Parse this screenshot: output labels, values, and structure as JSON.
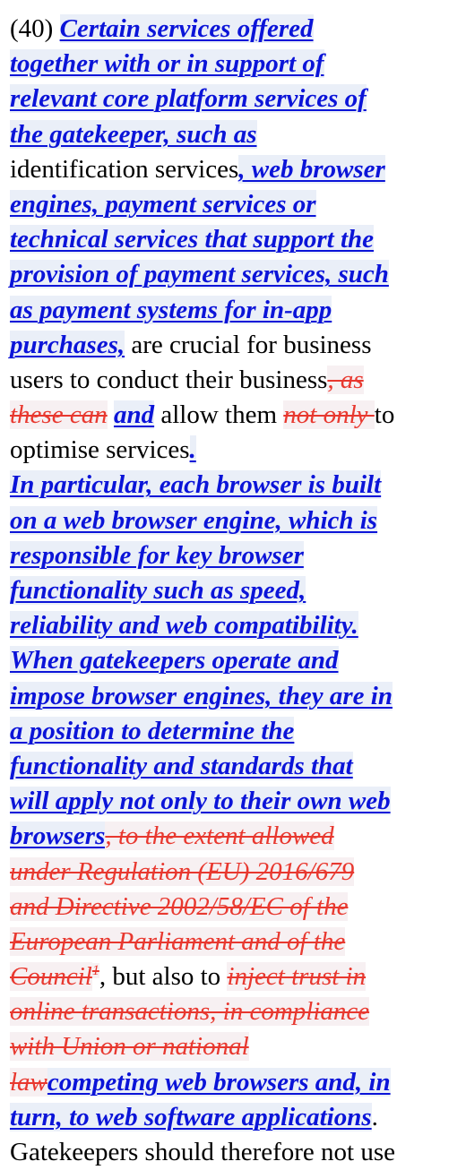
{
  "document": {
    "recital_number": "(40)",
    "colors": {
      "inserted_text": "#0b14d8",
      "deleted_text": "#e8382f",
      "plain_text": "#000000",
      "insert_highlight": "#eaeff8",
      "delete_highlight": "#f7f0f2"
    },
    "lines": [
      [
        {
          "t": "num",
          "v": "(40)  "
        },
        {
          "t": "ins",
          "v": "Certain services offered"
        }
      ],
      [
        {
          "t": "ins",
          "v": "together with or in support of"
        }
      ],
      [
        {
          "t": "ins",
          "v": "relevant core platform services of"
        }
      ],
      [
        {
          "t": "ins",
          "v": "the gatekeeper, such as"
        }
      ],
      [
        {
          "t": "plain",
          "v": "identification services"
        },
        {
          "t": "ins",
          "v": ", web browser"
        }
      ],
      [
        {
          "t": "ins",
          "v": "engines, payment services or"
        }
      ],
      [
        {
          "t": "ins",
          "v": "technical services that support the"
        }
      ],
      [
        {
          "t": "ins",
          "v": "provision of payment services, such"
        }
      ],
      [
        {
          "t": "ins",
          "v": "as payment systems for in-app"
        }
      ],
      [
        {
          "t": "ins",
          "v": "purchases,"
        },
        {
          "t": "plain",
          "v": " are crucial for business"
        }
      ],
      [
        {
          "t": "plain",
          "v": "users to conduct their business"
        },
        {
          "t": "del",
          "v": ", as"
        }
      ],
      [
        {
          "t": "del",
          "v": "these can"
        },
        {
          "t": "plain",
          "v": " "
        },
        {
          "t": "ins",
          "v": "and"
        },
        {
          "t": "plain",
          "v": " allow them "
        },
        {
          "t": "del",
          "v": "not only "
        },
        {
          "t": "plain",
          "v": "to"
        }
      ],
      [
        {
          "t": "plain",
          "v": "optimise services"
        },
        {
          "t": "ins",
          "v": "."
        }
      ],
      [
        {
          "t": "ins",
          "v": "In particular, each browser is built"
        }
      ],
      [
        {
          "t": "ins",
          "v": "on a web browser engine, which is"
        }
      ],
      [
        {
          "t": "ins",
          "v": "responsible for key browser"
        }
      ],
      [
        {
          "t": "ins",
          "v": "functionality such as speed,"
        }
      ],
      [
        {
          "t": "ins",
          "v": "reliability and web compatibility."
        }
      ],
      [
        {
          "t": "ins",
          "v": "When gatekeepers operate and"
        }
      ],
      [
        {
          "t": "ins",
          "v": "impose browser engines, they are in"
        }
      ],
      [
        {
          "t": "ins",
          "v": "a position to determine the"
        }
      ],
      [
        {
          "t": "ins",
          "v": "functionality and standards that"
        }
      ],
      [
        {
          "t": "ins",
          "v": "will apply not only to their own web"
        }
      ],
      [
        {
          "t": "ins",
          "v": "browsers"
        },
        {
          "t": "del",
          "v": ", to the extent allowed"
        }
      ],
      [
        {
          "t": "del",
          "v": "under Regulation (EU) 2016/679"
        }
      ],
      [
        {
          "t": "del",
          "v": "and Directive 2002/58/EC of the"
        }
      ],
      [
        {
          "t": "del",
          "v": "European Parliament and of the"
        }
      ],
      [
        {
          "t": "del",
          "v": "Council"
        },
        {
          "t": "delsup",
          "v": "1"
        },
        {
          "t": "plain",
          "v": ", but also to "
        },
        {
          "t": "del",
          "v": "inject trust in"
        }
      ],
      [
        {
          "t": "del",
          "v": "online transactions, in compliance"
        }
      ],
      [
        {
          "t": "del",
          "v": "with Union or national"
        }
      ],
      [
        {
          "t": "del",
          "v": "law"
        },
        {
          "t": "ins",
          "v": "competing web browsers and, in"
        }
      ],
      [
        {
          "t": "ins",
          "v": "turn, to web software applications"
        },
        {
          "t": "plain",
          "v": "."
        }
      ],
      [
        {
          "t": "plain",
          "v": "Gatekeepers should therefore not use"
        }
      ]
    ]
  }
}
